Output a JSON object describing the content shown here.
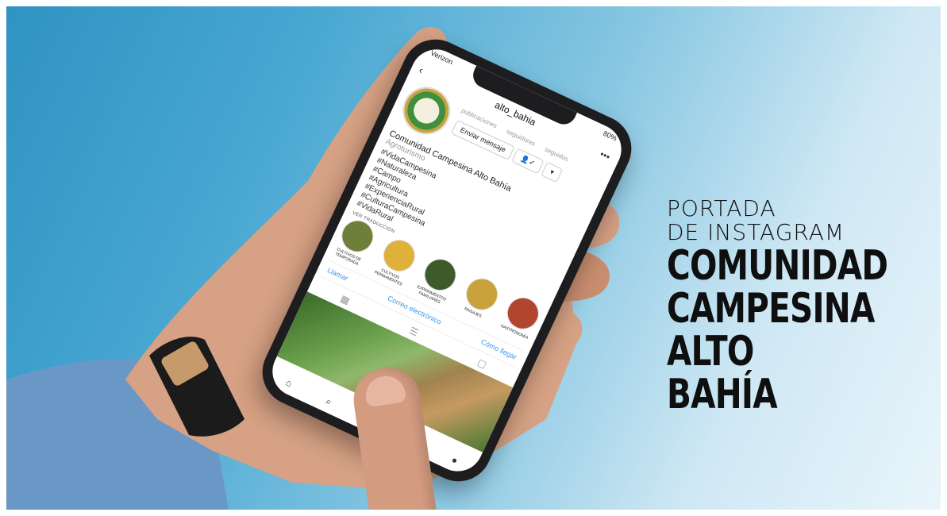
{
  "phone": {
    "status_left": "Verizon",
    "status_right": "80%",
    "username": "alto_bahia",
    "stats": [
      "publicaciones",
      "seguidores",
      "seguidos"
    ],
    "message_button": "Enviar mensaje",
    "profile_name": "Comunidad Campesina Alto Bahía",
    "category": "Agroturismo",
    "hashtags": [
      "#VidaCampesina",
      "#Naturaleza",
      "#Campo",
      "#Agricultura",
      "#ExperienciaRural",
      "#CulturaCampesina",
      "#VidaRural"
    ],
    "see_translation": "VER TRADUCCIÓN",
    "highlights": [
      {
        "label": "CULTIVOS DE TEMPORADA",
        "color": "#6e7f3a"
      },
      {
        "label": "CULTIVOS PERMANENTES",
        "color": "#e0b13a"
      },
      {
        "label": "EXPERIMENTOS FAMILIARES",
        "color": "#3d5a2a"
      },
      {
        "label": "PAISAJES",
        "color": "#c9a23b"
      },
      {
        "label": "GASTRONOMÍA",
        "color": "#b2452f"
      }
    ],
    "actions": [
      "Llamar",
      "Correo electrónico",
      "Cómo llegar"
    ]
  },
  "headline": {
    "line1": "PORTADA",
    "line2": "DE INSTAGRAM",
    "line3": "COMUNIDAD",
    "line4": "CAMPESINA",
    "line5": "ALTO BAHÍA"
  },
  "colors": {
    "sky_start": "#2f93c3",
    "sky_end": "#e9f5fb",
    "ig_link": "#3897f0"
  }
}
